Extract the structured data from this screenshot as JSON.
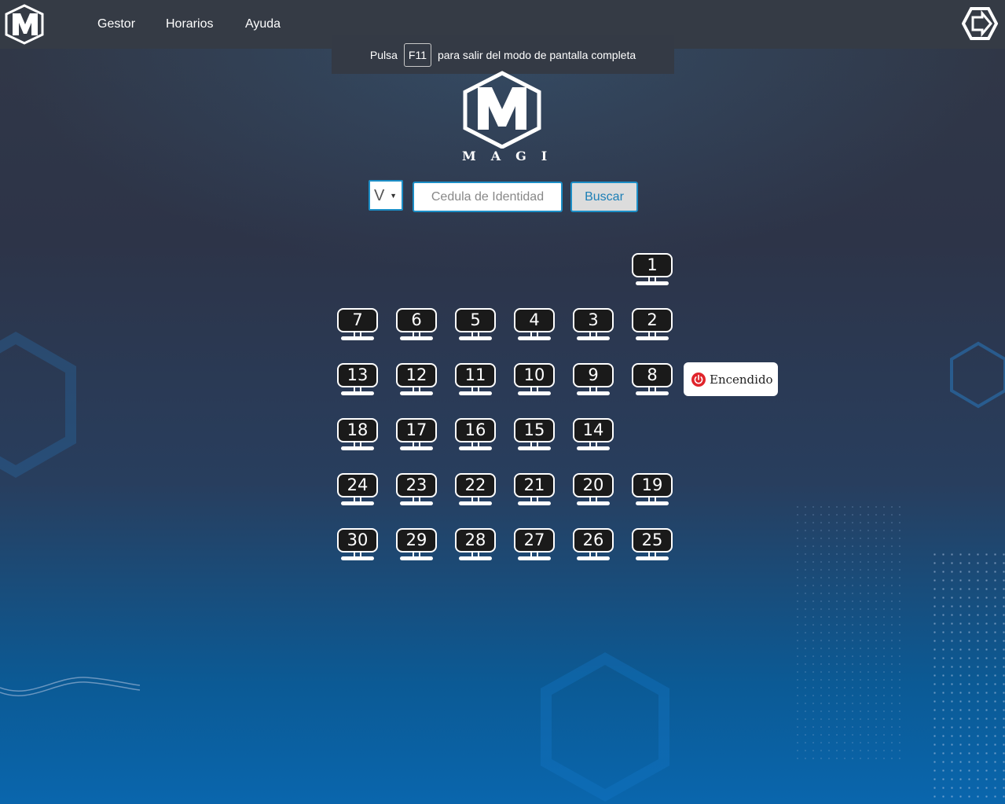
{
  "nav": {
    "links": [
      "Gestor",
      "Horarios",
      "Ayuda"
    ]
  },
  "fullscreen_notice": {
    "prefix": "Pulsa",
    "key": "F11",
    "suffix": "para salir del modo de pantalla completa"
  },
  "brand": {
    "name": "MAGI"
  },
  "search": {
    "doc_type": "V",
    "placeholder": "Cedula de Identidad",
    "button_label": "Buscar"
  },
  "computers": [
    {
      "number": "1",
      "state": "off"
    },
    {
      "number": "2",
      "state": "off"
    },
    {
      "number": "3",
      "state": "off"
    },
    {
      "number": "4",
      "state": "off"
    },
    {
      "number": "5",
      "state": "off"
    },
    {
      "number": "6",
      "state": "off"
    },
    {
      "number": "7",
      "state": "off"
    },
    {
      "number": "8",
      "state": "off"
    },
    {
      "number": "9",
      "state": "off"
    },
    {
      "number": "10",
      "state": "off"
    },
    {
      "number": "11",
      "state": "off"
    },
    {
      "number": "12",
      "state": "off"
    },
    {
      "number": "13",
      "state": "off"
    },
    {
      "number": "14",
      "state": "off"
    },
    {
      "number": "15",
      "state": "off"
    },
    {
      "number": "16",
      "state": "off"
    },
    {
      "number": "17",
      "state": "off"
    },
    {
      "number": "18",
      "state": "off"
    },
    {
      "number": "19",
      "state": "off"
    },
    {
      "number": "20",
      "state": "off"
    },
    {
      "number": "21",
      "state": "off"
    },
    {
      "number": "22",
      "state": "off"
    },
    {
      "number": "23",
      "state": "off"
    },
    {
      "number": "24",
      "state": "off"
    },
    {
      "number": "25",
      "state": "off"
    },
    {
      "number": "26",
      "state": "off"
    },
    {
      "number": "27",
      "state": "off"
    },
    {
      "number": "28",
      "state": "off"
    },
    {
      "number": "29",
      "state": "off"
    },
    {
      "number": "30",
      "state": "off"
    }
  ],
  "status_tooltip": {
    "label": "Encendido",
    "icon": "power-icon",
    "icon_color": "#e0242b"
  },
  "colors": {
    "accent": "#1c8ec6",
    "navbar": "#353b45"
  }
}
